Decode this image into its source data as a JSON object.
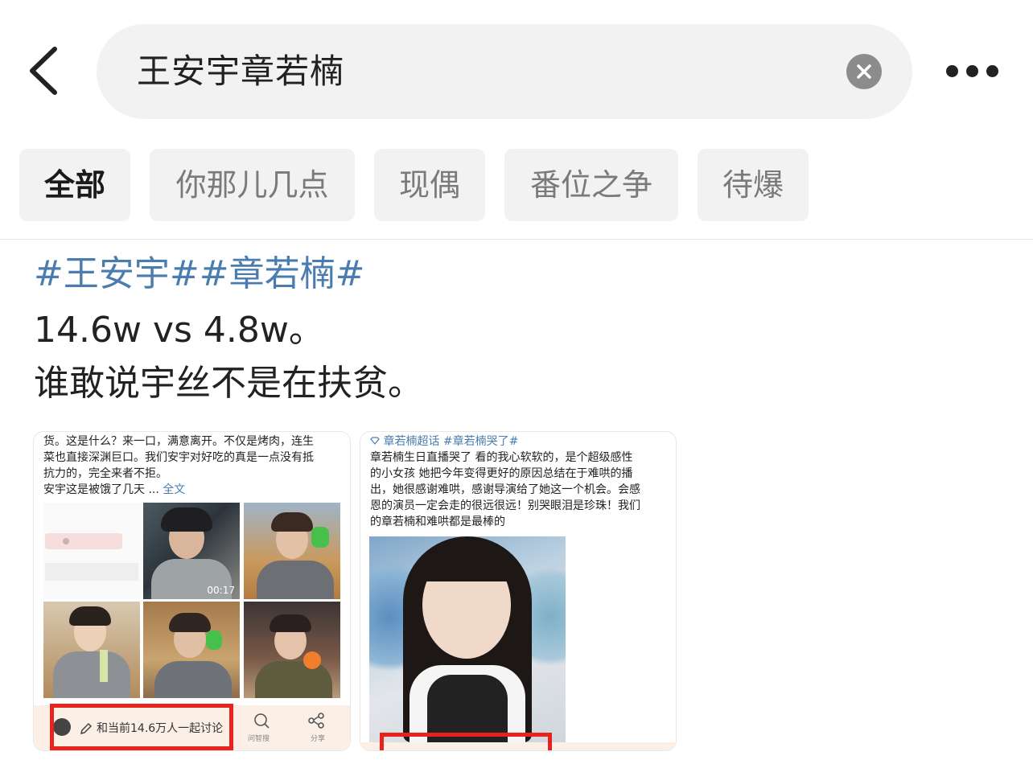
{
  "search": {
    "query": "王安宇章若楠"
  },
  "filters": [
    {
      "label": "全部",
      "active": true
    },
    {
      "label": "你那儿几点",
      "active": false
    },
    {
      "label": "现偶",
      "active": false
    },
    {
      "label": "番位之争",
      "active": false
    },
    {
      "label": "待爆",
      "active": false
    }
  ],
  "post": {
    "tags": [
      "#王安宇#",
      "#章若楠#"
    ],
    "lines": [
      "14.6w vs 4.8w。",
      "谁敢说宇丝不是在扶贫。"
    ]
  },
  "screenshot_left": {
    "text_lines": [
      "货。这是什么？来一口，满意离开。不仅是烤肉，连生",
      "菜也直接深渊巨口。我们安宇对好吃的真是一点没有抵",
      "抗力的，完全来者不拒。",
      "安宇这是被饿了几天 ... "
    ],
    "full_text_link": "全文",
    "video_duration": "00:17",
    "discussion_label": "和当前14.6万人一起讨论",
    "action_1": "问智搜",
    "action_2": "分享"
  },
  "screenshot_right": {
    "tag_line": "章若楠超话 #章若楠哭了#",
    "text_lines": [
      "章若楠生日直播哭了 看的我心软软的，是个超级感性",
      "的小女孩 她把今年变得更好的原因总结在于难哄的播",
      "出，她很感谢难哄，感谢导演给了她这一个机会。会感",
      "恩的演员一定会走的很远很远！别哭眼泪是珍珠！我们",
      "的章若楠和难哄都是最棒的"
    ]
  },
  "colors": {
    "tag_blue": "#4a7cb0",
    "highlight_red": "#e8231d",
    "chip_bg": "#f2f2f2"
  }
}
